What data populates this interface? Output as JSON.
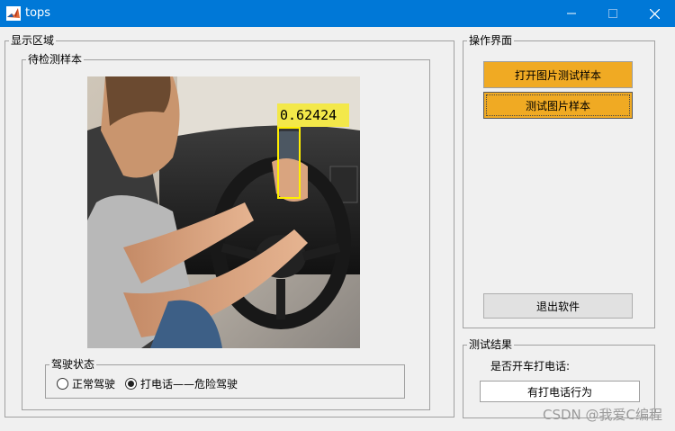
{
  "window": {
    "title": "tops"
  },
  "display_panel": {
    "legend": "显示区域",
    "sample_panel": {
      "legend": "待检测样本",
      "detection": {
        "score": "0.62424",
        "box_color": "#ffef00",
        "label_bg": "#f3e84a"
      }
    },
    "driving_state": {
      "legend": "驾驶状态",
      "options": [
        {
          "label": "正常驾驶",
          "checked": false
        },
        {
          "label": "打电话——危险驾驶",
          "checked": true
        }
      ]
    }
  },
  "ops_panel": {
    "legend": "操作界面",
    "open_button": "打开图片测试样本",
    "test_button": "测试图片样本",
    "exit_button": "退出软件"
  },
  "result_panel": {
    "legend": "测试结果",
    "question": "是否开车打电话:",
    "answer": "有打电话行为"
  },
  "watermark": "CSDN @我爱C编程",
  "colors": {
    "titlebar": "#0078d7",
    "accent_button": "#f0aa23",
    "window_bg": "#f0f0f0"
  }
}
